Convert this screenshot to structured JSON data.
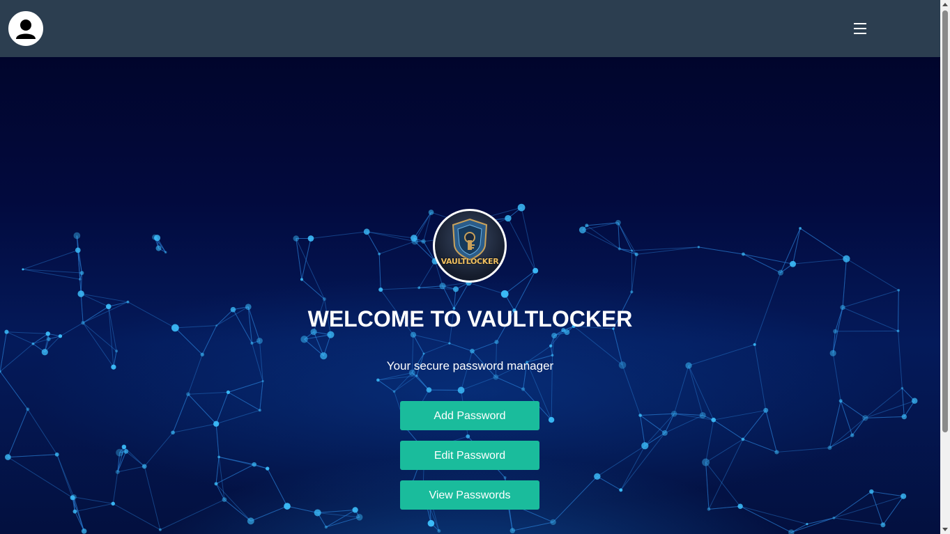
{
  "navbar": {
    "avatar_icon": "user-avatar-icon",
    "menu_icon": "hamburger-menu-icon",
    "menu_glyph": "☰",
    "background": "#2c3e50"
  },
  "hero": {
    "logo_text": "VAULTLOCKER",
    "title": "WELCOME TO VAULTLOCKER",
    "subtitle": "Your secure password manager",
    "background_theme": "blue network mesh"
  },
  "actions": {
    "add_label": "Add Password",
    "edit_label": "Edit Password",
    "view_label": "View Passwords",
    "button_color": "#1abc9c"
  }
}
